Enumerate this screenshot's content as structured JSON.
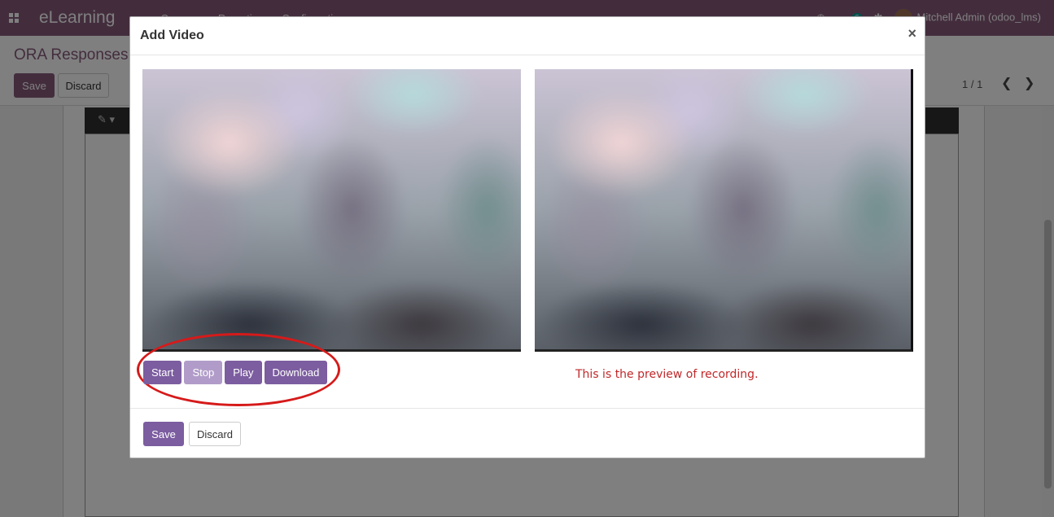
{
  "app": {
    "title": "eLearning",
    "menu": [
      "Courses",
      "Reporting",
      "Configuration"
    ],
    "user": "Mitchell Admin (odoo_lms)",
    "message_count": "6",
    "accent_color": "#875a7b"
  },
  "control_panel": {
    "breadcrumb": "ORA Responses /",
    "save_label": "Save",
    "discard_label": "Discard",
    "pager": "1 / 1"
  },
  "modal": {
    "title": "Add Video",
    "close": "×",
    "buttons": {
      "start": "Start",
      "stop": "Stop",
      "play": "Play",
      "download": "Download"
    },
    "preview_note": "This is the preview of recording.",
    "footer": {
      "save_label": "Save",
      "discard_label": "Discard"
    }
  },
  "icons": [
    "apps-grid-icon",
    "clock-icon",
    "chat-icon",
    "bug-icon",
    "magic-wand-icon",
    "close-icon",
    "chevron-left-icon",
    "chevron-right-icon"
  ]
}
